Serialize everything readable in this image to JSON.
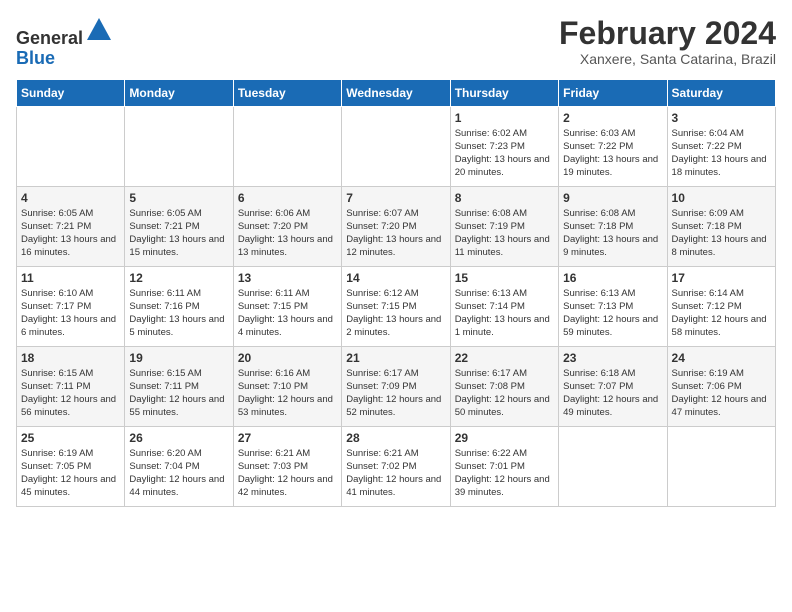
{
  "header": {
    "logo_line1": "General",
    "logo_line2": "Blue",
    "month_title": "February 2024",
    "subtitle": "Xanxere, Santa Catarina, Brazil"
  },
  "calendar": {
    "days_of_week": [
      "Sunday",
      "Monday",
      "Tuesday",
      "Wednesday",
      "Thursday",
      "Friday",
      "Saturday"
    ],
    "weeks": [
      [
        {
          "day": "",
          "info": ""
        },
        {
          "day": "",
          "info": ""
        },
        {
          "day": "",
          "info": ""
        },
        {
          "day": "",
          "info": ""
        },
        {
          "day": "1",
          "info": "Sunrise: 6:02 AM\nSunset: 7:23 PM\nDaylight: 13 hours\nand 20 minutes."
        },
        {
          "day": "2",
          "info": "Sunrise: 6:03 AM\nSunset: 7:22 PM\nDaylight: 13 hours\nand 19 minutes."
        },
        {
          "day": "3",
          "info": "Sunrise: 6:04 AM\nSunset: 7:22 PM\nDaylight: 13 hours\nand 18 minutes."
        }
      ],
      [
        {
          "day": "4",
          "info": "Sunrise: 6:05 AM\nSunset: 7:21 PM\nDaylight: 13 hours\nand 16 minutes."
        },
        {
          "day": "5",
          "info": "Sunrise: 6:05 AM\nSunset: 7:21 PM\nDaylight: 13 hours\nand 15 minutes."
        },
        {
          "day": "6",
          "info": "Sunrise: 6:06 AM\nSunset: 7:20 PM\nDaylight: 13 hours\nand 13 minutes."
        },
        {
          "day": "7",
          "info": "Sunrise: 6:07 AM\nSunset: 7:20 PM\nDaylight: 13 hours\nand 12 minutes."
        },
        {
          "day": "8",
          "info": "Sunrise: 6:08 AM\nSunset: 7:19 PM\nDaylight: 13 hours\nand 11 minutes."
        },
        {
          "day": "9",
          "info": "Sunrise: 6:08 AM\nSunset: 7:18 PM\nDaylight: 13 hours\nand 9 minutes."
        },
        {
          "day": "10",
          "info": "Sunrise: 6:09 AM\nSunset: 7:18 PM\nDaylight: 13 hours\nand 8 minutes."
        }
      ],
      [
        {
          "day": "11",
          "info": "Sunrise: 6:10 AM\nSunset: 7:17 PM\nDaylight: 13 hours\nand 6 minutes."
        },
        {
          "day": "12",
          "info": "Sunrise: 6:11 AM\nSunset: 7:16 PM\nDaylight: 13 hours\nand 5 minutes."
        },
        {
          "day": "13",
          "info": "Sunrise: 6:11 AM\nSunset: 7:15 PM\nDaylight: 13 hours\nand 4 minutes."
        },
        {
          "day": "14",
          "info": "Sunrise: 6:12 AM\nSunset: 7:15 PM\nDaylight: 13 hours\nand 2 minutes."
        },
        {
          "day": "15",
          "info": "Sunrise: 6:13 AM\nSunset: 7:14 PM\nDaylight: 13 hours\nand 1 minute."
        },
        {
          "day": "16",
          "info": "Sunrise: 6:13 AM\nSunset: 7:13 PM\nDaylight: 12 hours\nand 59 minutes."
        },
        {
          "day": "17",
          "info": "Sunrise: 6:14 AM\nSunset: 7:12 PM\nDaylight: 12 hours\nand 58 minutes."
        }
      ],
      [
        {
          "day": "18",
          "info": "Sunrise: 6:15 AM\nSunset: 7:11 PM\nDaylight: 12 hours\nand 56 minutes."
        },
        {
          "day": "19",
          "info": "Sunrise: 6:15 AM\nSunset: 7:11 PM\nDaylight: 12 hours\nand 55 minutes."
        },
        {
          "day": "20",
          "info": "Sunrise: 6:16 AM\nSunset: 7:10 PM\nDaylight: 12 hours\nand 53 minutes."
        },
        {
          "day": "21",
          "info": "Sunrise: 6:17 AM\nSunset: 7:09 PM\nDaylight: 12 hours\nand 52 minutes."
        },
        {
          "day": "22",
          "info": "Sunrise: 6:17 AM\nSunset: 7:08 PM\nDaylight: 12 hours\nand 50 minutes."
        },
        {
          "day": "23",
          "info": "Sunrise: 6:18 AM\nSunset: 7:07 PM\nDaylight: 12 hours\nand 49 minutes."
        },
        {
          "day": "24",
          "info": "Sunrise: 6:19 AM\nSunset: 7:06 PM\nDaylight: 12 hours\nand 47 minutes."
        }
      ],
      [
        {
          "day": "25",
          "info": "Sunrise: 6:19 AM\nSunset: 7:05 PM\nDaylight: 12 hours\nand 45 minutes."
        },
        {
          "day": "26",
          "info": "Sunrise: 6:20 AM\nSunset: 7:04 PM\nDaylight: 12 hours\nand 44 minutes."
        },
        {
          "day": "27",
          "info": "Sunrise: 6:21 AM\nSunset: 7:03 PM\nDaylight: 12 hours\nand 42 minutes."
        },
        {
          "day": "28",
          "info": "Sunrise: 6:21 AM\nSunset: 7:02 PM\nDaylight: 12 hours\nand 41 minutes."
        },
        {
          "day": "29",
          "info": "Sunrise: 6:22 AM\nSunset: 7:01 PM\nDaylight: 12 hours\nand 39 minutes."
        },
        {
          "day": "",
          "info": ""
        },
        {
          "day": "",
          "info": ""
        }
      ]
    ]
  }
}
